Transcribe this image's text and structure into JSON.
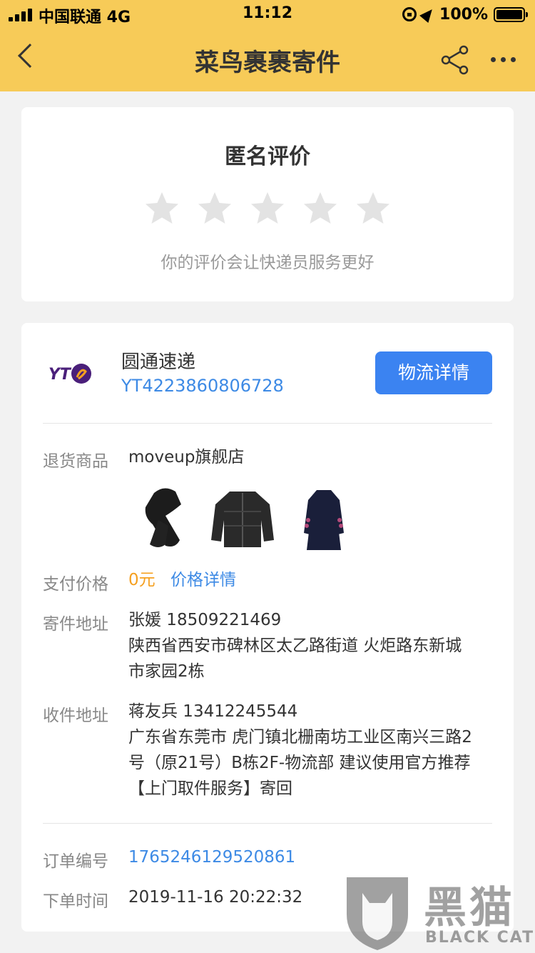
{
  "status_bar": {
    "carrier": "中国联通 4G",
    "time": "11:12",
    "battery": "100%"
  },
  "nav": {
    "title": "菜鸟裹裹寄件",
    "icons": [
      "back-icon",
      "share-icon",
      "more-icon"
    ]
  },
  "rating": {
    "title": "匿名评价",
    "stars_total": 5,
    "stars_selected": 0,
    "hint": "你的评价会让快递员服务更好"
  },
  "courier": {
    "logo_text": "YT",
    "name": "圆通速递",
    "tracking_number": "YT4223860806728",
    "logistics_button": "物流详情"
  },
  "details": {
    "goods_label": "退货商品",
    "shop": "moveup旗舰店",
    "products": [
      "scarf",
      "down-jacket",
      "dress"
    ],
    "price_label": "支付价格",
    "price": "0元",
    "price_link": "价格详情",
    "sender_label": "寄件地址",
    "sender_line1": "张媛 18509221469",
    "sender_line2": "陕西省西安市碑林区太乙路街道 火炬路东新城",
    "sender_line3": "市家园2栋",
    "receiver_label": "收件地址",
    "receiver_line1": "蒋友兵 13412245544",
    "receiver_line2": "广东省东莞市 虎门镇北栅南坊工业区南兴三路2",
    "receiver_line3": "号（原21号）B栋2F-物流部 建议使用官方推荐",
    "receiver_line4": "【上门取件服务】寄回",
    "order_label": "订单编号",
    "order_number": "1765246129520861",
    "time_label": "下单时间",
    "order_time": "2019-11-16 20:22:32"
  },
  "watermark": {
    "cn": "黑猫",
    "en": "BLACK CAT"
  },
  "colors": {
    "header": "#f7cb58",
    "accent_blue": "#3b83f1",
    "link_blue": "#3d8ae5",
    "price_orange": "#f5a020"
  }
}
